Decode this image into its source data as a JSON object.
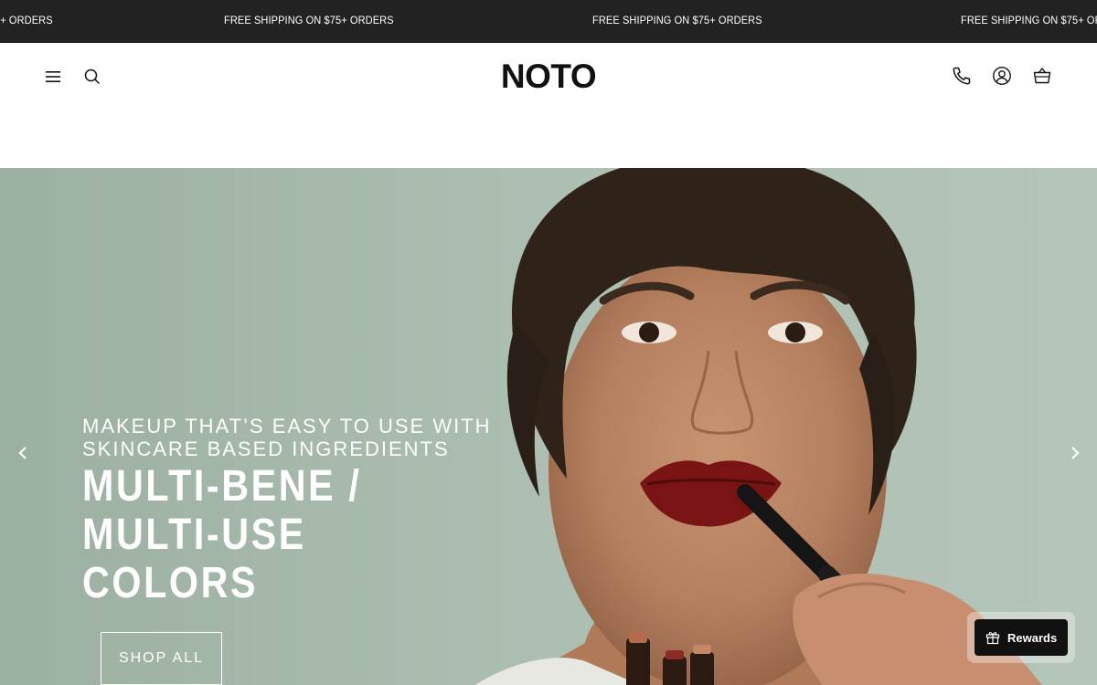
{
  "announcement": {
    "messages": [
      "FREE SHIPPING ON $75+ ORDERS",
      "FREE SHIPPING ON $75+ ORDERS",
      "FREE SHIPPING ON $75+ ORDERS",
      "FREE SHIPPING ON $75+ ORDERS"
    ]
  },
  "header": {
    "logo": "NOTO",
    "icons": {
      "menu": "hamburger-menu-icon",
      "search": "search-icon",
      "phone": "phone-icon",
      "account": "account-icon",
      "cart": "cart-icon"
    }
  },
  "hero": {
    "subtitle": "MAKEUP THAT’S EASY TO USE WITH SKINCARE BASED INGREDIENTS",
    "title": "MULTI-BENE / MULTI-USE COLORS",
    "cta_label": "SHOP ALL",
    "prev_icon": "chevron-left-icon",
    "next_icon": "chevron-right-icon"
  },
  "rewards": {
    "label": "Rewards",
    "icon": "gift-icon"
  },
  "colors": {
    "announcement_bg": "#222222",
    "hero_bg": "#a9bcae",
    "lip_color": "#7a1414",
    "rewards_bg": "#111111"
  }
}
